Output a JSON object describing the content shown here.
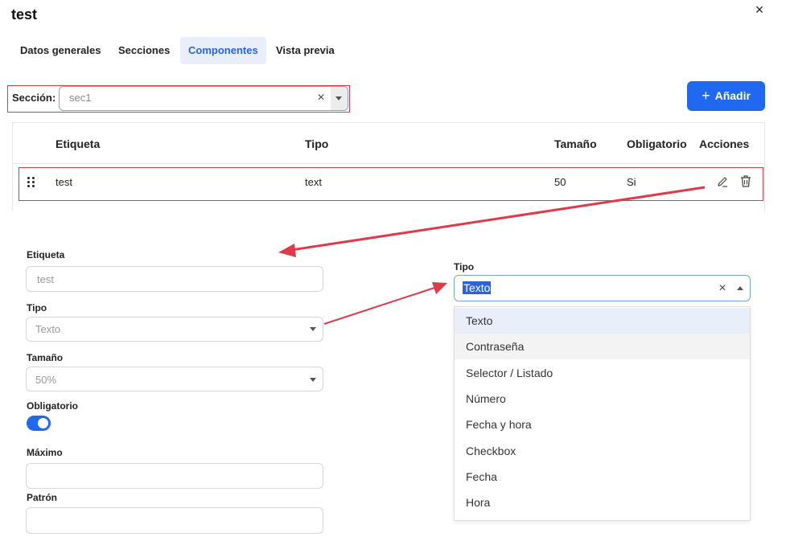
{
  "dialog": {
    "title": "test",
    "close_icon": "close-icon"
  },
  "tabs": [
    {
      "label": "Datos generales",
      "active": false
    },
    {
      "label": "Secciones",
      "active": false
    },
    {
      "label": "Componentes",
      "active": true
    },
    {
      "label": "Vista previa",
      "active": false
    }
  ],
  "section": {
    "label": "Sección:",
    "value": "sec1",
    "clear_icon": "clear-icon",
    "caret_icon": "chevron-down-icon"
  },
  "add_button": {
    "label": "Añadir",
    "icon": "plus-icon"
  },
  "table": {
    "headers": [
      "Etiqueta",
      "Tipo",
      "Tamaño",
      "Obligatorio",
      "Acciones"
    ],
    "rows": [
      {
        "etiqueta": "test",
        "tipo": "text",
        "tamano": "50",
        "obligatorio": "Si",
        "icons": [
          "drag-handle-icon",
          "edit-icon",
          "trash-icon"
        ]
      }
    ]
  },
  "form": {
    "etiqueta": {
      "label": "Etiqueta",
      "value": "test"
    },
    "tipo": {
      "label": "Tipo",
      "value": "Texto"
    },
    "tamano": {
      "label": "Tamaño",
      "value": "50%"
    },
    "obligatorio": {
      "label": "Obligatorio",
      "on": true
    },
    "maximo": {
      "label": "Máximo",
      "value": ""
    },
    "patron": {
      "label": "Patrón",
      "value": ""
    }
  },
  "tipo_dropdown": {
    "label": "Tipo",
    "value": "Texto",
    "options": [
      "Texto",
      "Contraseña",
      "Selector / Listado",
      "Número",
      "Fecha y hora",
      "Checkbox",
      "Fecha",
      "Hora"
    ],
    "selected_index": 0,
    "hover_index": 1
  },
  "colors": {
    "accent": "#2168f0",
    "annotation": "#e03a4a",
    "tab_active_bg": "#e9eefb"
  }
}
